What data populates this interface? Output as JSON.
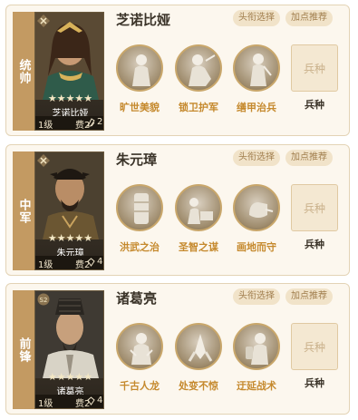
{
  "cards": [
    {
      "role": "统帅",
      "name": "芝诺比娅",
      "stars": "★★★★★",
      "level": "1级",
      "cost": "费2",
      "count": "2",
      "btn_title": "头衔选择",
      "btn_points": "加点推荐",
      "skills": [
        "旷世美貌",
        "锁卫护军",
        "缮甲治兵"
      ],
      "troop_box": "兵种",
      "troop_label": "兵种"
    },
    {
      "role": "中军",
      "name": "朱元璋",
      "stars": "★★★★★",
      "level": "1级",
      "cost": "费2",
      "count": "4",
      "btn_title": "头衔选择",
      "btn_points": "加点推荐",
      "skills": [
        "洪武之治",
        "圣智之谋",
        "画地而守"
      ],
      "troop_box": "兵种",
      "troop_label": "兵种"
    },
    {
      "role": "前锋",
      "name": "诸葛亮",
      "stars": "★★★★★",
      "level": "1级",
      "cost": "费2",
      "count": "4",
      "btn_title": "头衔选择",
      "btn_points": "加点推荐",
      "skills": [
        "千古人龙",
        "处变不惊",
        "迂延战术"
      ],
      "troop_box": "兵种",
      "troop_label": "兵种"
    }
  ],
  "colors": {
    "role_bar": "#c39a62",
    "skill_label": "#c5892d",
    "pill_bg": "#f1e3c9",
    "card_bg": "#fcf7ee"
  },
  "icons": [
    "hero-portrait",
    "star-icon",
    "wedge-icon",
    "skill-statue-icon",
    "badge-icon"
  ]
}
